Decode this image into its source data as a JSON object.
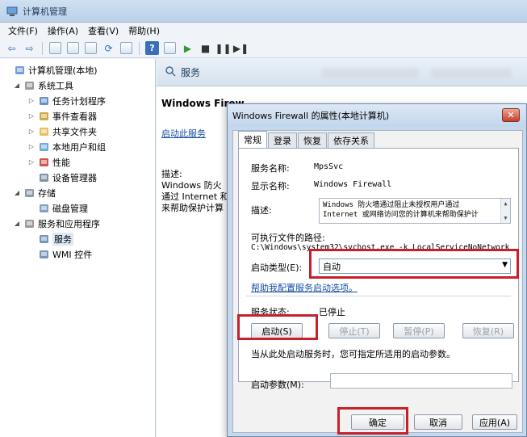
{
  "window": {
    "title": "计算机管理"
  },
  "menu": [
    "文件(F)",
    "操作(A)",
    "查看(V)",
    "帮助(H)"
  ],
  "tree": [
    {
      "label": "计算机管理(本地)",
      "level": 0,
      "expander": "",
      "icon": "computer-icon"
    },
    {
      "label": "系统工具",
      "level": 1,
      "expander": "◢",
      "icon": "tools-icon"
    },
    {
      "label": "任务计划程序",
      "level": 2,
      "expander": "▷",
      "icon": "clock-icon"
    },
    {
      "label": "事件查看器",
      "level": 2,
      "expander": "▷",
      "icon": "event-viewer-icon"
    },
    {
      "label": "共享文件夹",
      "level": 2,
      "expander": "▷",
      "icon": "shared-folder-icon"
    },
    {
      "label": "本地用户和组",
      "level": 2,
      "expander": "▷",
      "icon": "users-icon"
    },
    {
      "label": "性能",
      "level": 2,
      "expander": "▷",
      "icon": "performance-icon"
    },
    {
      "label": "设备管理器",
      "level": 2,
      "expander": "",
      "icon": "device-manager-icon"
    },
    {
      "label": "存储",
      "level": 1,
      "expander": "◢",
      "icon": "storage-icon"
    },
    {
      "label": "磁盘管理",
      "level": 2,
      "expander": "",
      "icon": "disk-icon"
    },
    {
      "label": "服务和应用程序",
      "level": 1,
      "expander": "◢",
      "icon": "services-apps-icon"
    },
    {
      "label": "服务",
      "level": 2,
      "expander": "",
      "icon": "gear-icon",
      "selected": true
    },
    {
      "label": "WMI 控件",
      "level": 2,
      "expander": "",
      "icon": "wmi-icon"
    }
  ],
  "services_pane": {
    "header": "服务",
    "service_name": "Windows Firew",
    "start_link": "启动此服务",
    "desc_label": "描述:",
    "desc_lines": [
      "Windows 防火",
      "通过 Internet 和",
      "来帮助保护计算"
    ]
  },
  "dialog": {
    "title": "Windows Firewall 的属性(本地计算机)",
    "close": "✕",
    "tabs": [
      "常规",
      "登录",
      "恢复",
      "依存关系"
    ],
    "fields": {
      "service_name_label": "服务名称:",
      "service_name_value": "MpsSvc",
      "display_name_label": "显示名称:",
      "display_name_value": "Windows Firewall",
      "desc_label": "描述:",
      "desc_value_1": "Windows 防火墙通过阻止未授权用户通过",
      "desc_value_2": "Internet 或网络访问您的计算机来帮助保护计",
      "path_label": "可执行文件的路径:",
      "path_value": "C:\\Windows\\system32\\svchost.exe -k LocalServiceNoNetwork",
      "startup_type_label": "启动类型(E):",
      "startup_type_value": "自动",
      "help_link": "帮助我配置服务启动选项。",
      "status_label": "服务状态:",
      "status_value": "已停止",
      "hint": "当从此处启动服务时，您可指定所适用的启动参数。",
      "param_label": "启动参数(M):"
    },
    "buttons": {
      "start": "启动(S)",
      "stop": "停止(T)",
      "pause": "暂停(P)",
      "resume": "恢复(R)",
      "ok": "确定",
      "cancel": "取消",
      "apply": "应用(A)"
    }
  },
  "colors": {
    "highlight": "#c8202a",
    "link": "#1a4fa3"
  }
}
